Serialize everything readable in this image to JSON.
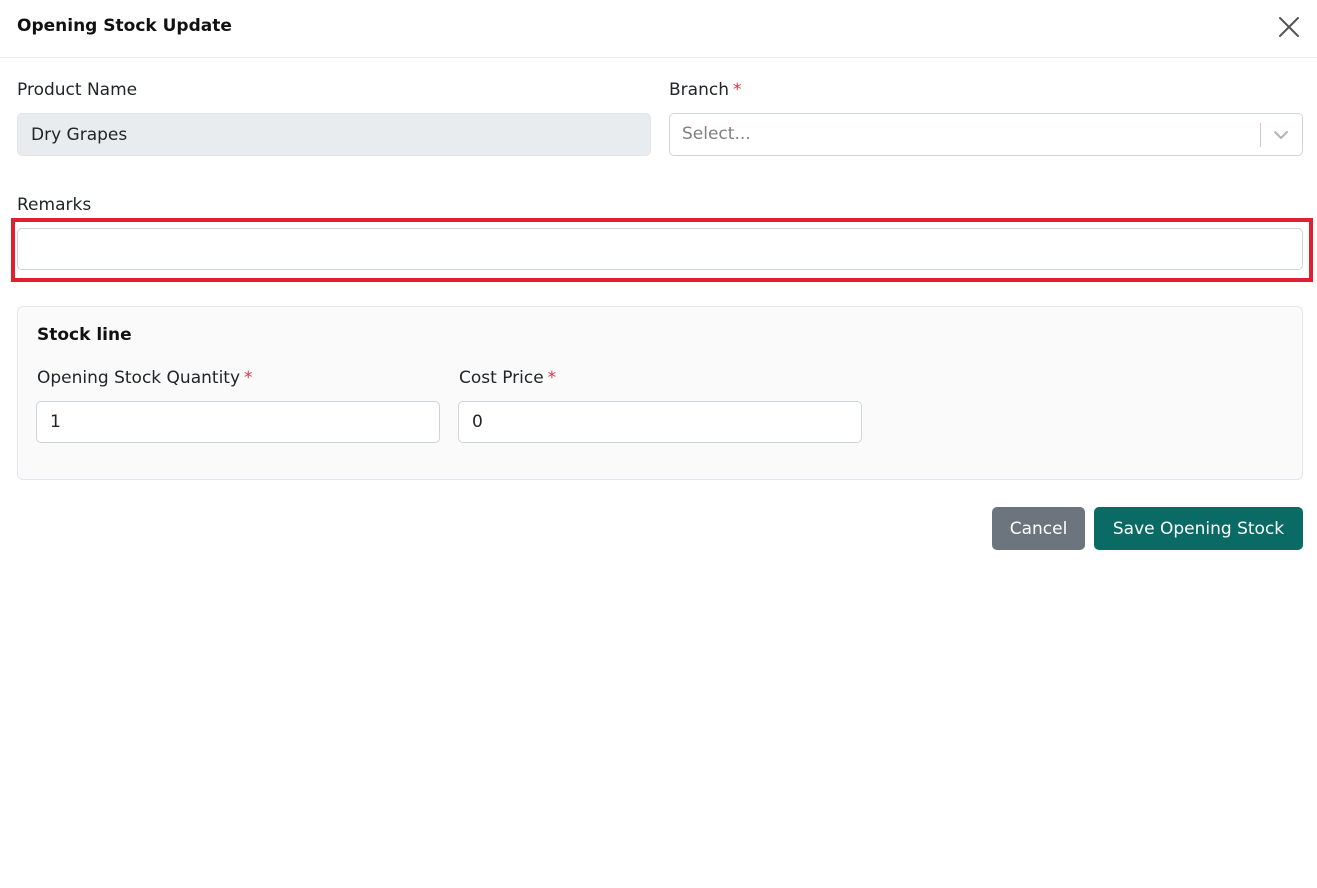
{
  "modal": {
    "title": "Opening Stock Update",
    "close_icon": "close-icon"
  },
  "form": {
    "product_name": {
      "label": "Product Name",
      "value": "Dry Grapes"
    },
    "branch": {
      "label": "Branch",
      "required_mark": "*",
      "placeholder": "Select..."
    },
    "remarks": {
      "label": "Remarks",
      "value": ""
    }
  },
  "stock_line": {
    "title": "Stock line",
    "quantity": {
      "label": "Opening Stock Quantity",
      "required_mark": "*",
      "value": "1"
    },
    "cost_price": {
      "label": "Cost Price",
      "required_mark": "*",
      "value": "0"
    }
  },
  "actions": {
    "cancel_label": "Cancel",
    "save_label": "Save Opening Stock"
  },
  "colors": {
    "primary": "#0a6b64",
    "secondary": "#6c757d",
    "required": "#dc3545",
    "highlight": "#e0202e"
  }
}
